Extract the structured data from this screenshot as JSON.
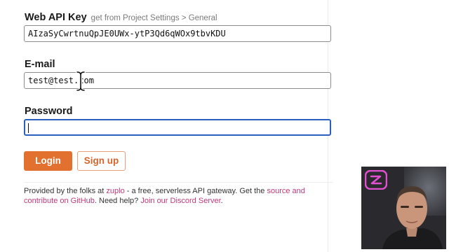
{
  "form": {
    "api_key": {
      "label": "Web API Key",
      "hint": "get from Project Settings > General",
      "value": "AIzaSyCwrtnuQpJE0UWx-ytP3Qd6qWOx9tbvKDU"
    },
    "email": {
      "label": "E-mail",
      "value": "test@test.com"
    },
    "password": {
      "label": "Password",
      "value": ""
    },
    "login_label": "Login",
    "signup_label": "Sign up"
  },
  "footer": {
    "text_1": "Provided by the folks at ",
    "link_zuplo": "zuplo",
    "text_2": " - a free, serverless API gateway. Get the ",
    "link_source": "source and contribute on GitHub",
    "text_3": ". Need help? ",
    "link_discord": "Join our Discord Server",
    "text_4": "."
  },
  "colors": {
    "accent": "#e2702f",
    "link": "#c0397a",
    "focus": "#2b5fbf"
  },
  "icons": {
    "cursor": "text-cursor-icon",
    "webcam_logo": "zuplo-logo-icon"
  }
}
